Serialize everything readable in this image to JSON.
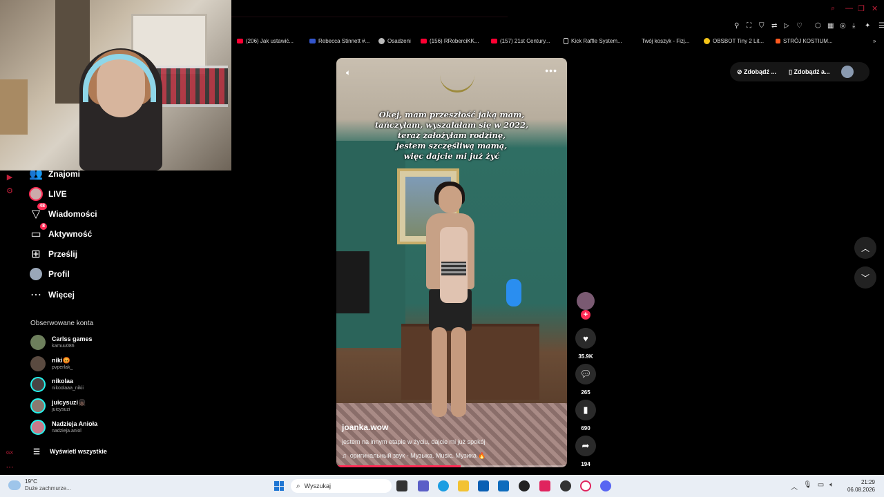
{
  "browser": {
    "bookmarks": [
      {
        "label": "(206) Jak ustawić...",
        "icon": "youtube-icon",
        "color": "#ff0033"
      },
      {
        "label": "Rebecca Stinnett #...",
        "icon": "site-icon",
        "color": "#3355cc"
      },
      {
        "label": "Osadzeni",
        "icon": "avatar-icon",
        "color": "#bbbbbb"
      },
      {
        "label": "(156) RRoberciKK...",
        "icon": "youtube-icon",
        "color": "#ff0033"
      },
      {
        "label": "(157) 21st Century...",
        "icon": "youtube-icon",
        "color": "#ff0033"
      },
      {
        "label": "Kick Raffle System...",
        "icon": "page-icon",
        "color": "#dddddd"
      },
      {
        "label": "Twój koszyk - Fizj...",
        "icon": "none",
        "color": "#000000"
      },
      {
        "label": "OBSBOT Tiny 2 Lit...",
        "icon": "obsbot-icon",
        "color": "#f5c518"
      },
      {
        "label": "STRÓJ KOSTIUM...",
        "icon": "shop-icon",
        "color": "#ff5a1f"
      }
    ],
    "accent_color": "#c41f3a"
  },
  "promo": {
    "coins_label": "Zdobądź ...",
    "app_label": "Zdobądź a..."
  },
  "sidebar": {
    "nav": [
      {
        "label": "Znajomi",
        "icon": "friends-icon"
      },
      {
        "label": "LIVE",
        "icon": "live-avatar"
      },
      {
        "label": "Wiadomości",
        "icon": "messages-icon",
        "badge": "48"
      },
      {
        "label": "Aktywność",
        "icon": "activity-icon",
        "badge": "8"
      },
      {
        "label": "Prześlij",
        "icon": "upload-icon"
      },
      {
        "label": "Profil",
        "icon": "profile-avatar"
      },
      {
        "label": "Więcej",
        "icon": "more-icon"
      }
    ],
    "following_title": "Obserwowane konta",
    "accounts": [
      {
        "name": "Carlss games",
        "handle": "kamuu086"
      },
      {
        "name": "niki😡",
        "handle": "pvperlak_"
      },
      {
        "name": "nikolaa",
        "handle": "nikoolaaa_nikii"
      },
      {
        "name": "juicysuzi👧🏿",
        "handle": "juicysuzi"
      },
      {
        "name": "Nadzieja Anioła",
        "handle": "nadzieja.aniol"
      }
    ],
    "see_all_label": "Wyświetl wszystkie"
  },
  "video": {
    "caption": "Okej, mam przeszłość jaką mam,\ntańczyłam, wyszalałam się w 2022,\nteraz założyłam rodzinę,\njestem szczęśliwą mamą,\nwięc dajcie mi już żyć",
    "author": "joanka.wow",
    "description": "jestem na innym etapie w życiu, dajcie mi już spokój",
    "sound": "оригинальный звук - Музыка. Music. Музика 🔥",
    "progress": 0.54,
    "accent_color": "#fe2c55"
  },
  "actions": {
    "likes": "35.9K",
    "comments": "265",
    "saves": "690",
    "shares": "194"
  },
  "taskbar": {
    "weather_temp": "19°C",
    "weather_cond": "Duże zachmurze...",
    "search_placeholder": "Wyszukaj",
    "time": "21:29",
    "date": "06.08.2026"
  }
}
